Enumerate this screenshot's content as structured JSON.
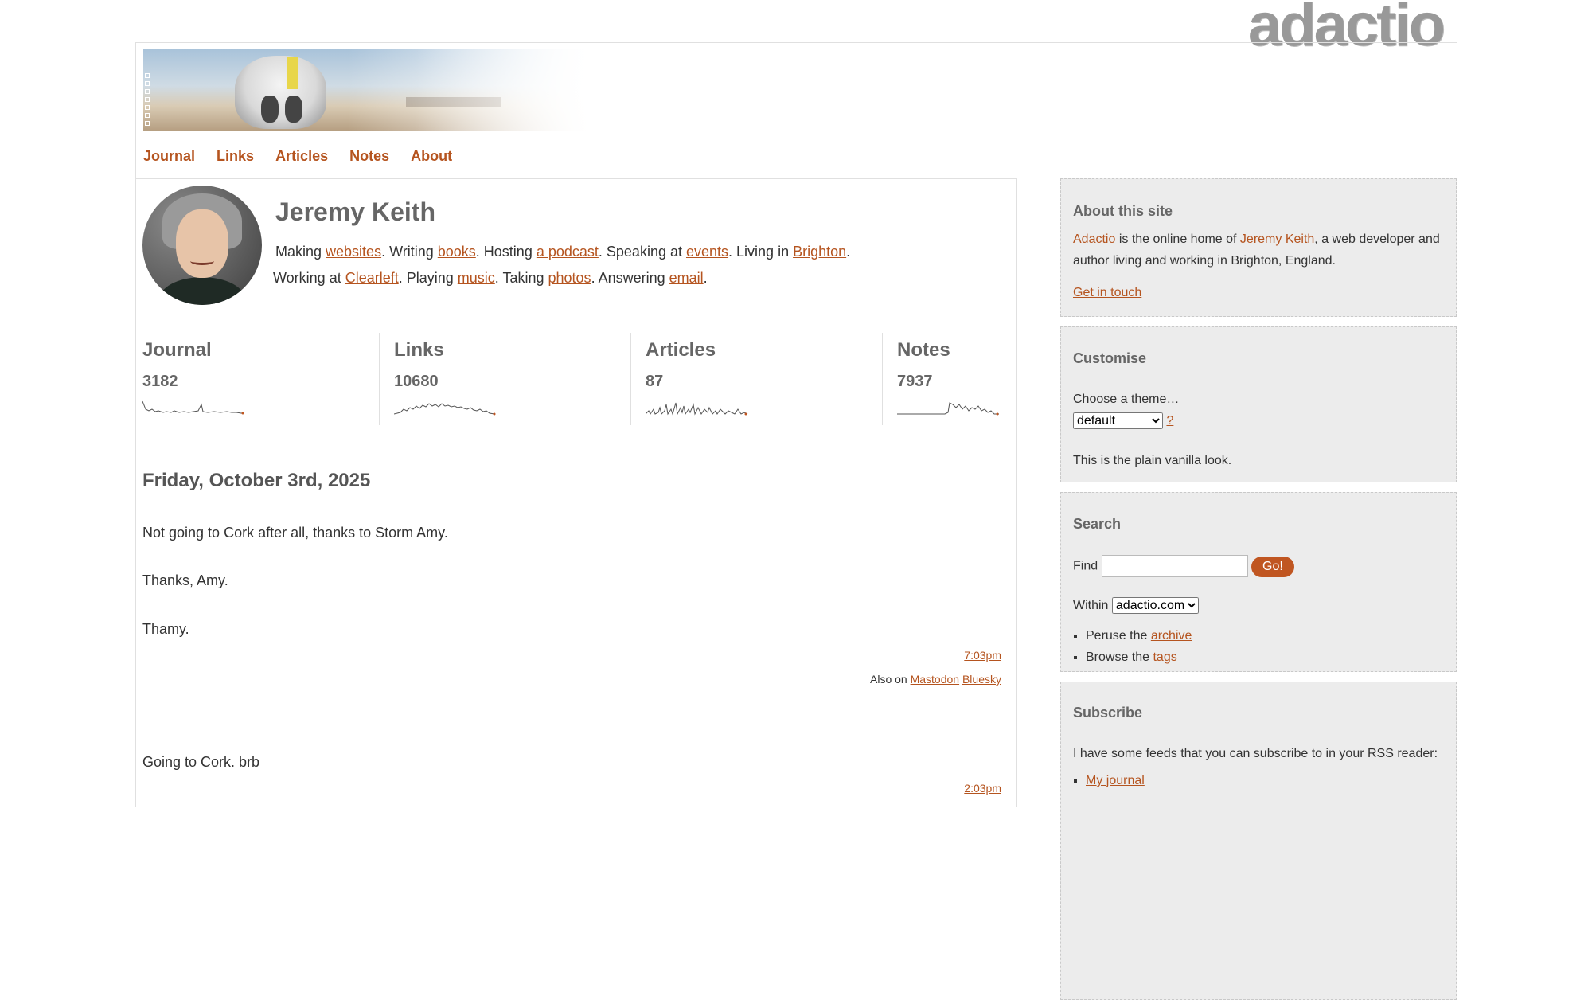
{
  "site": {
    "logo": "adactio"
  },
  "nav": [
    "Journal",
    "Links",
    "Articles",
    "Notes",
    "About"
  ],
  "profile": {
    "name": "Jeremy Keith",
    "intro": [
      {
        "t": "Making "
      },
      {
        "a": "websites"
      },
      {
        "t": ". Writing "
      },
      {
        "a": "books"
      },
      {
        "t": ". Hosting "
      },
      {
        "a": "a podcast"
      },
      {
        "t": ". Speaking at "
      },
      {
        "a": "events"
      },
      {
        "t": ". Living in "
      },
      {
        "a": "Brighton"
      },
      {
        "t": "."
      }
    ],
    "intro2": [
      {
        "t": "Working at "
      },
      {
        "a": "Clearleft"
      },
      {
        "t": ". Playing "
      },
      {
        "a": "music"
      },
      {
        "t": ". Taking "
      },
      {
        "a": "photos"
      },
      {
        "t": ". Answering "
      },
      {
        "a": "email"
      },
      {
        "t": "."
      }
    ]
  },
  "stats": [
    {
      "label": "Journal",
      "count": "3182"
    },
    {
      "label": "Links",
      "count": "10680"
    },
    {
      "label": "Articles",
      "count": "87"
    },
    {
      "label": "Notes",
      "count": "7937"
    }
  ],
  "feed": {
    "date": "Friday, October 3rd, 2025",
    "entry1": [
      "Not going to Cork after all, thanks to Storm Amy.",
      "Thanks, Amy.",
      "Thamy."
    ],
    "entry1_time": "7:03pm",
    "also_on": "Also on",
    "syndication": [
      "Mastodon",
      "Bluesky"
    ],
    "entry2": "Going to Cork. brb",
    "entry2_time": "2:03pm"
  },
  "sidebar": {
    "about": {
      "title": "About this site",
      "site_link": "Adactio",
      "text1": " is the online home of ",
      "person_link": "Jeremy Keith",
      "text2": ", a web developer and author living and working in Brighton, England.",
      "contact": "Get in touch"
    },
    "customise": {
      "title": "Customise",
      "label": "Choose a theme…",
      "selected": "default",
      "help": "?",
      "description": "This is the plain vanilla look."
    },
    "search": {
      "title": "Search",
      "find_label": "Find",
      "go": "Go!",
      "within_label": "Within",
      "within_selected": "adactio.com",
      "peruse": "Peruse the ",
      "archive": "archive",
      "browse": "Browse the ",
      "tags": "tags"
    },
    "subscribe": {
      "title": "Subscribe",
      "text": "I have some feeds that you can subscribe to in your RSS reader:",
      "journal": "My journal"
    }
  }
}
